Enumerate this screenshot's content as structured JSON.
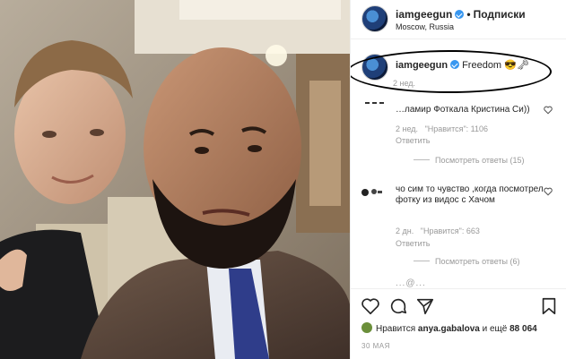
{
  "post": {
    "username": "iamgeegun",
    "separator": "•",
    "follow_label": "Подписки",
    "location": "Moscow, Russia"
  },
  "caption": {
    "username": "iamgeegun",
    "text": "Freedom 😎🗝",
    "time": "2 нед."
  },
  "comments": [
    {
      "text": "…ламир Фоткала Кристина Си))",
      "time": "2 нед.",
      "likes": "\"Нравится\": 1106",
      "reply_label": "Ответить",
      "view_replies": "Посмотреть ответы (15)"
    },
    {
      "text": "чо сим то чувство ,когда посмотрел фотку из видос с Хачом",
      "time": "2 дн.",
      "likes": "\"Нравится\": 663",
      "reply_label": "Ответить",
      "view_replies": "Посмотреть ответы (6)"
    }
  ],
  "partial_comment": "...@...",
  "likes": {
    "prefix": "Нравится",
    "user": "anya.gabalova",
    "suffix": "и ещё",
    "count": "88 064"
  },
  "date": "30 МАЯ",
  "icons": [
    "heart-icon",
    "comment-icon",
    "share-icon",
    "bookmark-icon",
    "verified-badge-icon"
  ],
  "colors": {
    "verified": "#3897f0",
    "muted": "#999999",
    "text": "#262626"
  }
}
